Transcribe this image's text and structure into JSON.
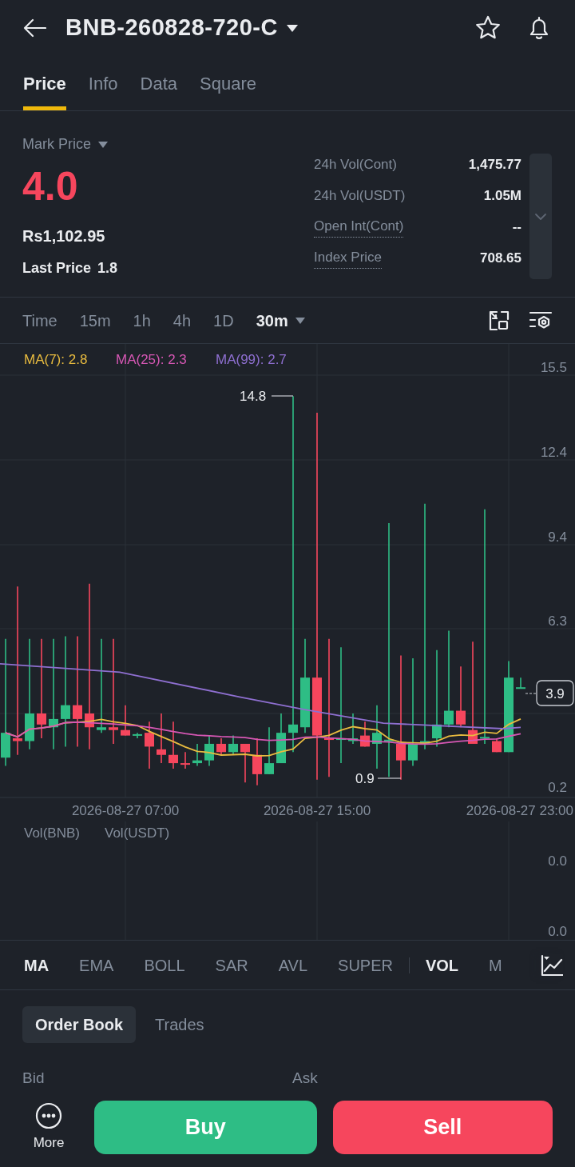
{
  "header": {
    "title": "BNB-260828-720-C"
  },
  "tabs": [
    {
      "label": "Price",
      "selected": true
    },
    {
      "label": "Info",
      "selected": false
    },
    {
      "label": "Data",
      "selected": false
    },
    {
      "label": "Square",
      "selected": false
    }
  ],
  "mark_price": {
    "label": "Mark Price",
    "value": "4.0",
    "fiat": "Rs1,102.95",
    "last_price_label": "Last Price",
    "last_price": "1.8"
  },
  "stats": [
    {
      "label": "24h Vol(Cont)",
      "value": "1,475.77",
      "underlined": false
    },
    {
      "label": "24h Vol(USDT)",
      "value": "1.05M",
      "underlined": false
    },
    {
      "label": "Open Int(Cont)",
      "value": "--",
      "underlined": true
    },
    {
      "label": "Index Price",
      "value": "708.65",
      "underlined": true
    }
  ],
  "intervals": [
    {
      "label": "Time",
      "selected": false
    },
    {
      "label": "15m",
      "selected": false
    },
    {
      "label": "1h",
      "selected": false
    },
    {
      "label": "4h",
      "selected": false
    },
    {
      "label": "1D",
      "selected": false
    },
    {
      "label": "30m",
      "selected": true
    }
  ],
  "moving_averages": [
    {
      "label": "MA(7): 2.8",
      "color": "#e8bb3f"
    },
    {
      "label": "MA(25): 2.3",
      "color": "#d657b4"
    },
    {
      "label": "MA(99): 2.7",
      "color": "#8e6fd0"
    }
  ],
  "price_axis": [
    "15.5",
    "12.4",
    "9.4",
    "6.3",
    "0.2"
  ],
  "price_markers": {
    "high": "14.8",
    "low": "0.9",
    "current": "3.9"
  },
  "time_axis": [
    "2026-08-27 07:00",
    "2026-08-27 15:00",
    "2026-08-27 23:00"
  ],
  "volume": {
    "labels": [
      "Vol(BNB)",
      "Vol(USDT)"
    ],
    "axis": [
      "0.0",
      "0.0"
    ]
  },
  "indicators": [
    {
      "label": "MA",
      "selected": true
    },
    {
      "label": "EMA",
      "selected": false
    },
    {
      "label": "BOLL",
      "selected": false
    },
    {
      "label": "SAR",
      "selected": false
    },
    {
      "label": "AVL",
      "selected": false
    },
    {
      "label": "SUPER",
      "selected": false
    },
    {
      "label": "VOL",
      "selected": true
    },
    {
      "label": "M",
      "selected": false
    }
  ],
  "book_tabs": [
    {
      "label": "Order Book",
      "selected": true
    },
    {
      "label": "Trades",
      "selected": false
    }
  ],
  "book_columns": [
    "Bid",
    "Ask"
  ],
  "bottom": {
    "more": "More",
    "buy": "Buy",
    "sell": "Sell"
  }
}
